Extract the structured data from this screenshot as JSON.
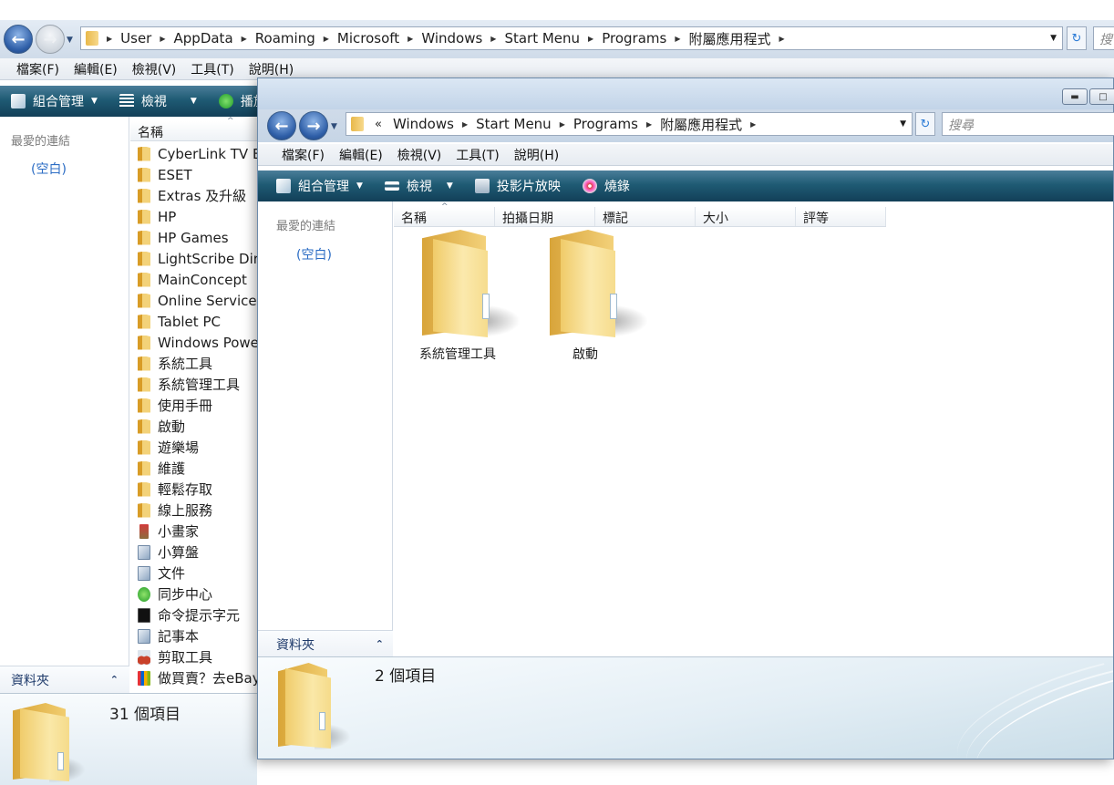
{
  "back_window": {
    "address": {
      "segments": [
        "User",
        "AppData",
        "Roaming",
        "Microsoft",
        "Windows",
        "Start Menu",
        "Programs",
        "附屬應用程式"
      ],
      "search_placeholder": "搜"
    },
    "menu": [
      "檔案(F)",
      "編輯(E)",
      "檢視(V)",
      "工具(T)",
      "說明(H)"
    ],
    "toolbar": {
      "organize": "組合管理",
      "views": "檢視",
      "play": "播放"
    },
    "nav": {
      "favorites_title": "最愛的連結",
      "favorites_empty": "(空白)",
      "folders_label": "資料夾"
    },
    "column_name": "名稱",
    "files": [
      {
        "name": "CyberLink TV Enhance",
        "icon": "folder"
      },
      {
        "name": "ESET",
        "icon": "folder"
      },
      {
        "name": "Extras 及升級",
        "icon": "folder"
      },
      {
        "name": "HP",
        "icon": "folder"
      },
      {
        "name": "HP Games",
        "icon": "folder"
      },
      {
        "name": "LightScribe Direct Disc Labeling",
        "icon": "folder"
      },
      {
        "name": "MainConcept",
        "icon": "folder"
      },
      {
        "name": "Online Services",
        "icon": "folder"
      },
      {
        "name": "Tablet PC",
        "icon": "folder"
      },
      {
        "name": "Windows PowerShell",
        "icon": "folder"
      },
      {
        "name": "系統工具",
        "icon": "folder"
      },
      {
        "name": "系統管理工具",
        "icon": "folder"
      },
      {
        "name": "使用手冊",
        "icon": "folder"
      },
      {
        "name": "啟動",
        "icon": "folder"
      },
      {
        "name": "遊樂場",
        "icon": "folder"
      },
      {
        "name": "維護",
        "icon": "folder"
      },
      {
        "name": "輕鬆存取",
        "icon": "folder"
      },
      {
        "name": "線上服務",
        "icon": "folder"
      },
      {
        "name": "小畫家",
        "icon": "brush"
      },
      {
        "name": "小算盤",
        "icon": "app"
      },
      {
        "name": "文件",
        "icon": "app"
      },
      {
        "name": "同步中心",
        "icon": "green"
      },
      {
        "name": "命令提示字元",
        "icon": "cmd"
      },
      {
        "name": "記事本",
        "icon": "app"
      },
      {
        "name": "剪取工具",
        "icon": "scissors"
      },
      {
        "name": "做買賣？去eBay",
        "icon": "ebay"
      }
    ],
    "status": "31 個項目"
  },
  "front_window": {
    "address": {
      "overflow": "«",
      "segments": [
        "Windows",
        "Start Menu",
        "Programs",
        "附屬應用程式"
      ],
      "search_placeholder": "搜尋"
    },
    "menu": [
      "檔案(F)",
      "編輯(E)",
      "檢視(V)",
      "工具(T)",
      "說明(H)"
    ],
    "toolbar": {
      "organize": "組合管理",
      "views": "檢視",
      "slideshow": "投影片放映",
      "burn": "燒錄"
    },
    "nav": {
      "favorites_title": "最愛的連結",
      "favorites_empty": "(空白)",
      "folders_label": "資料夾"
    },
    "columns": [
      "名稱",
      "拍攝日期",
      "標記",
      "大小",
      "評等"
    ],
    "items": [
      {
        "name": "系統管理工具"
      },
      {
        "name": "啟動"
      }
    ],
    "status": "2 個項目"
  },
  "colors": {
    "toolbar": "#1f5b74",
    "link": "#2b6cc4",
    "folder": "#f0cb69"
  }
}
